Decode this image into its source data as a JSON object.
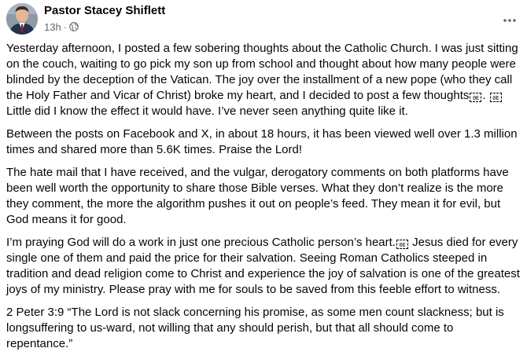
{
  "post": {
    "author": "Pastor Stacey Shiflett",
    "time": "13h",
    "separator": "·",
    "privacy_icon": "globe-icon",
    "more_icon": "more-options-icon",
    "emoji_box_text": "0E",
    "paragraphs": [
      {
        "segments": [
          {
            "t": "Yesterday afternoon, I posted a few sobering thoughts about the Catholic Church. I was just sitting on the couch, waiting to go pick my son up from school and thought about how many people were blinded by the deception of the Vatican. The joy over the installment of a new pope (who they call the Holy Father and Vicar of Christ) broke my heart, and I decided to post a few thoughts"
          },
          {
            "emoji": "unrendered-emoji-icon"
          },
          {
            "t": ". "
          },
          {
            "emoji": "unrendered-emoji-icon"
          },
          {
            "t": "Little did I know the effect it would have. I’ve never seen anything quite like it."
          }
        ]
      },
      {
        "segments": [
          {
            "t": "Between the posts on Facebook and X, in about 18 hours, it has been viewed well over 1.3 million times and shared more than 5.6K times. Praise the Lord!"
          }
        ]
      },
      {
        "segments": [
          {
            "t": "The hate mail that I have received, and the vulgar, derogatory comments on both platforms have been well worth the opportunity to share those Bible verses. What they don’t realize is the more they comment, the more the algorithm pushes it out on people’s feed. They mean it for evil, but God means it for good."
          }
        ]
      },
      {
        "segments": [
          {
            "t": "I’m praying God will do a work in just one precious Catholic person’s heart."
          },
          {
            "emoji": "unrendered-emoji-icon"
          },
          {
            "t": " Jesus died for every single one of them and paid the price for their salvation. Seeing Roman Catholics steeped in tradition and dead religion come to Christ and experience the joy of salvation is one of the greatest joys of my ministry. Please pray with me for souls to be saved from this feeble effort to witness."
          }
        ]
      },
      {
        "segments": [
          {
            "t": "2 Peter 3:9 “The Lord is not slack concerning his promise, as some men count slackness; but is longsuffering to us-ward, not willing that any should perish, but that all should come to repentance.”"
          }
        ]
      }
    ]
  }
}
